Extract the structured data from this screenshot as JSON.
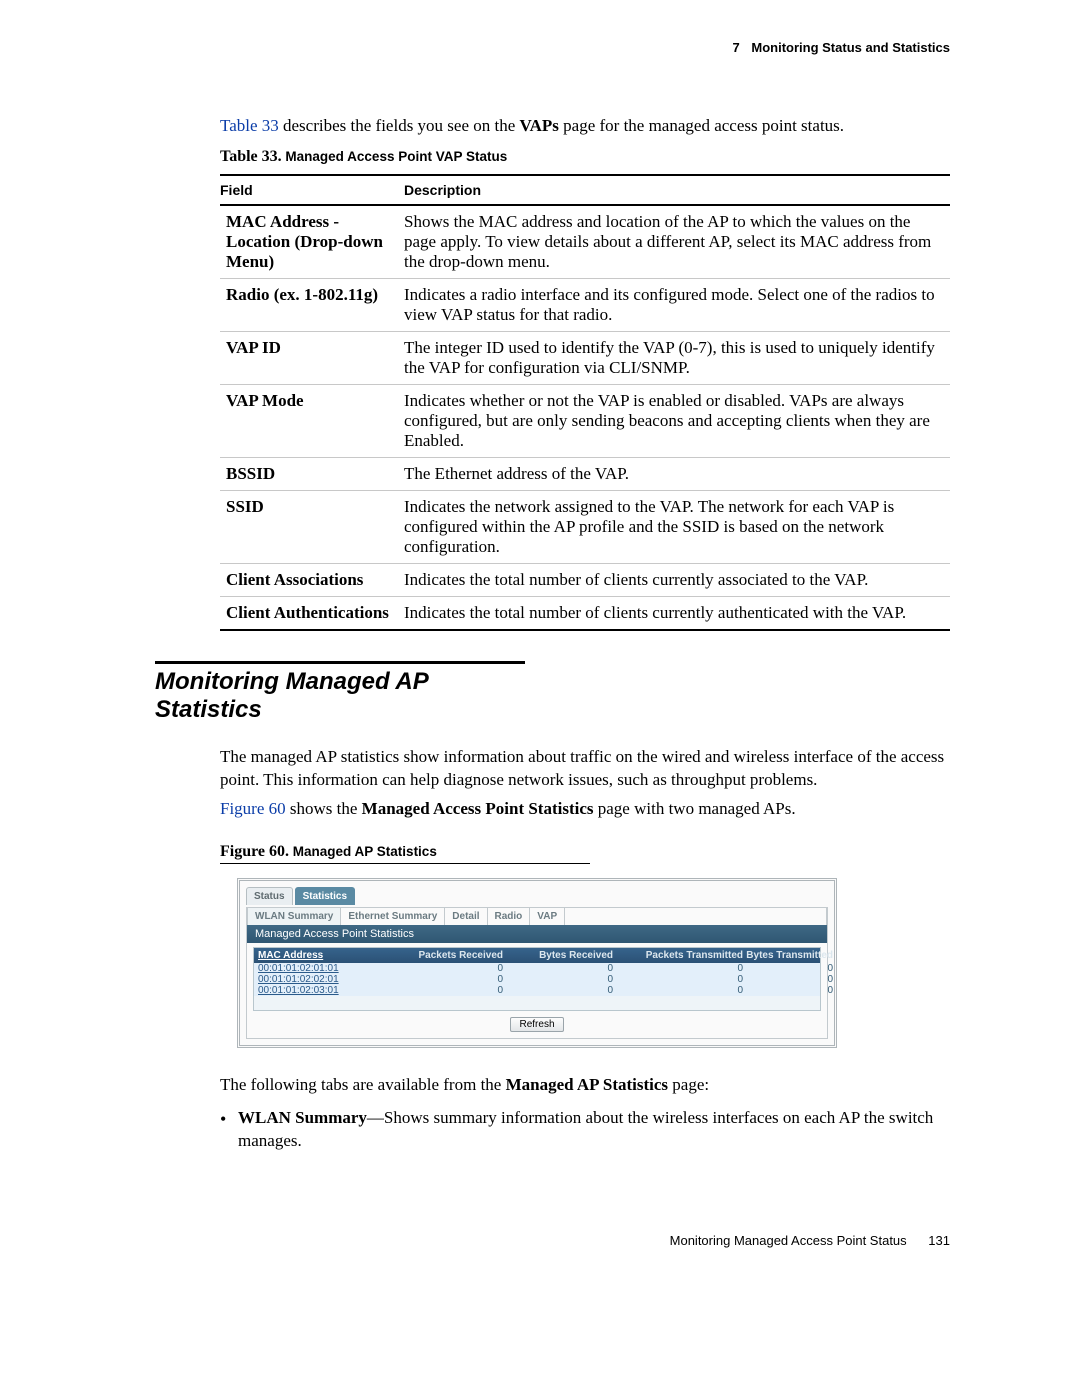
{
  "header": {
    "chapter_num": "7",
    "chapter_title": "Monitoring Status and Statistics"
  },
  "intro": {
    "ref": "Table 33",
    "rest1": " describes the fields you see on the ",
    "bold": "VAPs",
    "rest2": " page for the managed access point status."
  },
  "table33": {
    "caption_prefix": "Table 33.",
    "caption_title": " Managed Access Point VAP Status",
    "head_field": "Field",
    "head_desc": "Description",
    "rows": [
      {
        "field": "MAC Address - Location (Drop-down Menu)",
        "desc": "Shows the MAC address and location of the AP to which the values on the page apply. To view details about a different AP, select its MAC address from the drop-down menu."
      },
      {
        "field": "Radio (ex. 1-802.11g)",
        "desc": "Indicates a radio interface and its configured mode. Select one of the radios to view VAP status for that radio."
      },
      {
        "field": "VAP ID",
        "desc": "The integer ID used to identify the VAP (0-7), this is used to uniquely identify the VAP for configuration via CLI/SNMP."
      },
      {
        "field": "VAP Mode",
        "desc": "Indicates whether or not the VAP is enabled or disabled. VAPs are always configured, but are only sending beacons and accepting clients when they are Enabled."
      },
      {
        "field": "BSSID",
        "desc": "The Ethernet address of the VAP."
      },
      {
        "field": "SSID",
        "desc": "Indicates the network assigned to the VAP. The network for each VAP is configured within the AP profile and the SSID is based on the network configuration."
      },
      {
        "field": "Client Associations",
        "desc": "Indicates the total number of clients currently associated to the VAP."
      },
      {
        "field": "Client Authentications",
        "desc": "Indicates the total number of clients currently authenticated with the VAP."
      }
    ]
  },
  "section_heading": "Monitoring Managed AP Statistics",
  "section_para": "The managed AP statistics show information about traffic on the wired and wireless interface of the access point. This information can help diagnose network issues, such as throughput problems.",
  "fig_intro": {
    "ref": "Figure 60",
    "rest1": " shows the ",
    "bold": "Managed Access Point Statistics",
    "rest2": " page with two managed APs."
  },
  "figure60": {
    "caption_prefix": "Figure 60.",
    "caption_title": "  Managed AP Statistics",
    "tabs": {
      "status": "Status",
      "statistics": "Statistics"
    },
    "subtabs": {
      "wlan": "WLAN Summary",
      "eth": "Ethernet Summary",
      "detail": "Detail",
      "radio": "Radio",
      "vap": "VAP"
    },
    "bar": "Managed Access Point Statistics",
    "cols": {
      "mac": "MAC Address",
      "pr": "Packets Received",
      "br": "Bytes Received",
      "pt": "Packets Transmitted",
      "bt": "Bytes Transmitted"
    },
    "rows": [
      {
        "mac": "00:01:01:02:01:01",
        "pr": "0",
        "br": "0",
        "pt": "0",
        "bt": "0"
      },
      {
        "mac": "00:01:01:02:02:01",
        "pr": "0",
        "br": "0",
        "pt": "0",
        "bt": "0"
      },
      {
        "mac": "00:01:01:02:03:01",
        "pr": "0",
        "br": "0",
        "pt": "0",
        "bt": "0"
      }
    ],
    "refresh": "Refresh"
  },
  "after_fig": {
    "line": "The following tabs are available from the ",
    "bold": "Managed AP Statistics",
    "suffix": " page:"
  },
  "bullet": {
    "label": "WLAN Summary",
    "text": "—Shows summary information about the wireless interfaces on each AP the switch manages."
  },
  "footer": {
    "text": "Monitoring Managed Access Point Status",
    "page": "131"
  }
}
